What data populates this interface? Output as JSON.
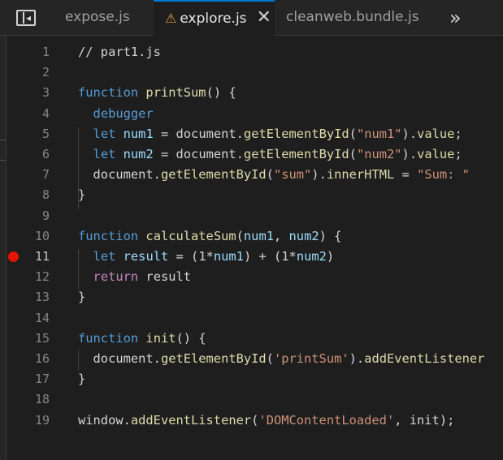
{
  "tabs": [
    {
      "label": "expose.js",
      "active": false
    },
    {
      "label": "explore.js",
      "active": true,
      "warning": true
    },
    {
      "label": "cleanweb.bundle.js",
      "active": false
    }
  ],
  "icons": {
    "sidebar_toggle": "sidebar-toggle-icon",
    "warning": "warning-triangle-icon",
    "close": "close-icon",
    "more": "chevron-double-right-icon"
  },
  "symbols": {
    "warning": "⚠",
    "close": "✕",
    "more": "»"
  },
  "colors": {
    "keyword": "#569cd6",
    "function": "#dcdcaa",
    "string": "#ce9178",
    "breakpoint": "#e51400",
    "accent": "#0078d4"
  },
  "editor": {
    "breakpoint_line": 11,
    "line_numbers": [
      "1",
      "2",
      "3",
      "4",
      "5",
      "6",
      "7",
      "8",
      "9",
      "10",
      "11",
      "12",
      "13",
      "14",
      "15",
      "16",
      "17",
      "18",
      "19"
    ],
    "lines": [
      [
        {
          "t": "// part1.js",
          "c": "cmgray"
        }
      ],
      [],
      [
        {
          "t": "function",
          "c": "kw"
        },
        {
          "t": " "
        },
        {
          "t": "printSum",
          "c": "fn"
        },
        {
          "t": "() {"
        }
      ],
      [
        {
          "t": "  "
        },
        {
          "t": "debugger",
          "c": "kw"
        }
      ],
      [
        {
          "t": "  "
        },
        {
          "t": "let",
          "c": "kw"
        },
        {
          "t": " "
        },
        {
          "t": "num1",
          "c": "var"
        },
        {
          "t": " = document."
        },
        {
          "t": "getElementById",
          "c": "fn"
        },
        {
          "t": "("
        },
        {
          "t": "\"num1\"",
          "c": "str"
        },
        {
          "t": ")."
        },
        {
          "t": "value",
          "c": "fn"
        },
        {
          "t": ";"
        }
      ],
      [
        {
          "t": "  "
        },
        {
          "t": "let",
          "c": "kw"
        },
        {
          "t": " "
        },
        {
          "t": "num2",
          "c": "var"
        },
        {
          "t": " = document."
        },
        {
          "t": "getElementById",
          "c": "fn"
        },
        {
          "t": "("
        },
        {
          "t": "\"num2\"",
          "c": "str"
        },
        {
          "t": ")."
        },
        {
          "t": "value",
          "c": "fn"
        },
        {
          "t": ";"
        }
      ],
      [
        {
          "t": "  document."
        },
        {
          "t": "getElementById",
          "c": "fn"
        },
        {
          "t": "("
        },
        {
          "t": "\"sum\"",
          "c": "str"
        },
        {
          "t": ")."
        },
        {
          "t": "innerHTML",
          "c": "fn"
        },
        {
          "t": " = "
        },
        {
          "t": "\"Sum: \"",
          "c": "str"
        }
      ],
      [
        {
          "t": "}"
        }
      ],
      [],
      [
        {
          "t": "function",
          "c": "kw"
        },
        {
          "t": " "
        },
        {
          "t": "calculateSum",
          "c": "fn"
        },
        {
          "t": "("
        },
        {
          "t": "num1",
          "c": "var"
        },
        {
          "t": ", "
        },
        {
          "t": "num2",
          "c": "var"
        },
        {
          "t": ") {"
        }
      ],
      [
        {
          "t": "  "
        },
        {
          "t": "let",
          "c": "kw"
        },
        {
          "t": " "
        },
        {
          "t": "result",
          "c": "var"
        },
        {
          "t": " = (1*"
        },
        {
          "t": "num1",
          "c": "var"
        },
        {
          "t": ") + (1*"
        },
        {
          "t": "num2",
          "c": "var"
        },
        {
          "t": ")"
        }
      ],
      [
        {
          "t": "  "
        },
        {
          "t": "return",
          "c": "ctl"
        },
        {
          "t": " result"
        }
      ],
      [
        {
          "t": "}"
        }
      ],
      [],
      [
        {
          "t": "function",
          "c": "kw"
        },
        {
          "t": " "
        },
        {
          "t": "init",
          "c": "fn"
        },
        {
          "t": "() {"
        }
      ],
      [
        {
          "t": "  document."
        },
        {
          "t": "getElementById",
          "c": "fn"
        },
        {
          "t": "("
        },
        {
          "t": "'printSum'",
          "c": "str"
        },
        {
          "t": ")."
        },
        {
          "t": "addEventListener",
          "c": "fn"
        }
      ],
      [
        {
          "t": "}"
        }
      ],
      [],
      [
        {
          "t": "window."
        },
        {
          "t": "addEventListener",
          "c": "fn"
        },
        {
          "t": "("
        },
        {
          "t": "'DOMContentLoaded'",
          "c": "str"
        },
        {
          "t": ", init);"
        }
      ]
    ]
  }
}
